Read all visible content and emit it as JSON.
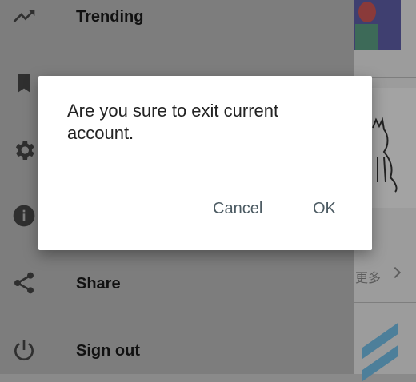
{
  "drawer": {
    "items": [
      {
        "label": "Trending",
        "icon": "trending-up-icon"
      },
      {
        "label": "",
        "icon": "bookmark-icon"
      },
      {
        "label": "",
        "icon": "settings-icon"
      },
      {
        "label": "",
        "icon": "info-icon"
      },
      {
        "label": "Share",
        "icon": "share-icon"
      },
      {
        "label": "Sign out",
        "icon": "power-icon"
      }
    ]
  },
  "background": {
    "more_label": "更多"
  },
  "dialog": {
    "message": "Are you sure to exit current account.",
    "cancel_label": "Cancel",
    "ok_label": "OK"
  },
  "colors": {
    "dialog_bg": "#ffffff",
    "scrim": "#7d7d7d",
    "button_text": "#4b5a62"
  }
}
